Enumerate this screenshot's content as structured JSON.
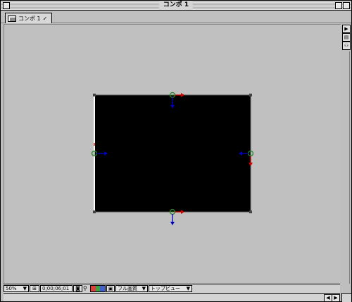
{
  "window": {
    "title": "コンポ 1"
  },
  "tab": {
    "label": "コンポ 1",
    "close_glyph": "✓"
  },
  "sidebar": {
    "buttons": [
      "▶",
      "▤",
      "⚇"
    ]
  },
  "bottom_bar": {
    "zoom": "50%",
    "timecode": "0;00;06;01",
    "resolution": "フル画質",
    "view": "トップビュー"
  },
  "colors": {
    "canvas": "#000000",
    "handle_green": "#2f7f2f",
    "axis_blue": "#0000c0",
    "axis_red": "#d00000"
  }
}
